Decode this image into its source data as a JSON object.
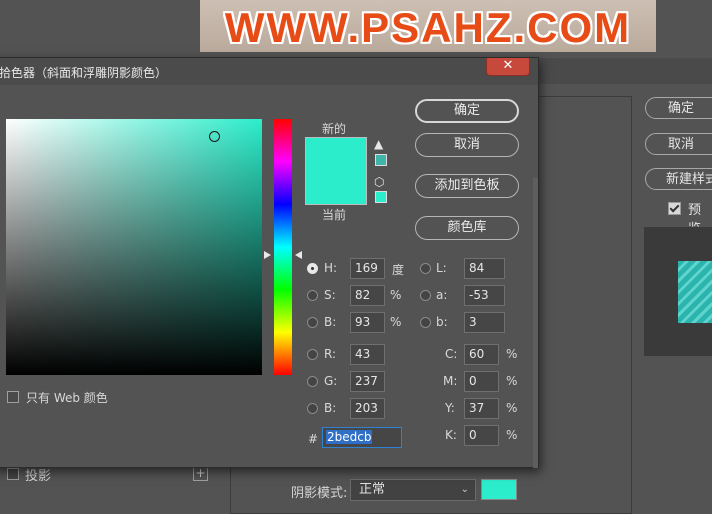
{
  "banner": {
    "text": "WWW.PSAHZ.COM"
  },
  "background_dialog": {
    "buttons": [
      "确定",
      "取消",
      "新建样式",
      "预览"
    ],
    "preview_checked": true,
    "layer_list": {
      "shadow_label": "投影",
      "add_icon": "plus-icon"
    },
    "shadow_mode": {
      "label": "阴影模式:",
      "value": "正常",
      "swatch_color": "#2bedcb"
    }
  },
  "picker": {
    "title": "拾色器（斜面和浮雕阴影颜色）",
    "close_label": "✕",
    "new_label": "新的",
    "current_label": "当前",
    "new_color": "#2bedcb",
    "current_color": "#2bedcb",
    "warning_icon": "gamut-warning-icon",
    "web_icon": "web-safe-cube-icon",
    "buttons": {
      "ok": "确定",
      "cancel": "取消",
      "add_swatch": "添加到色板",
      "libraries": "颜色库"
    },
    "web_only_label": "只有 Web 颜色",
    "hsb": {
      "h": {
        "label": "H:",
        "value": "169",
        "unit": "度"
      },
      "s": {
        "label": "S:",
        "value": "82",
        "unit": "%"
      },
      "b": {
        "label": "B:",
        "value": "93",
        "unit": "%"
      }
    },
    "rgb": {
      "r": {
        "label": "R:",
        "value": "43"
      },
      "g": {
        "label": "G:",
        "value": "237"
      },
      "b": {
        "label": "B:",
        "value": "203"
      }
    },
    "lab": {
      "l": {
        "label": "L:",
        "value": "84"
      },
      "a": {
        "label": "a:",
        "value": "-53"
      },
      "b": {
        "label": "b:",
        "value": "3"
      }
    },
    "cmyk": {
      "c": {
        "label": "C:",
        "value": "60",
        "unit": "%"
      },
      "m": {
        "label": "M:",
        "value": "0",
        "unit": "%"
      },
      "y": {
        "label": "Y:",
        "value": "37",
        "unit": "%"
      },
      "k": {
        "label": "K:",
        "value": "0",
        "unit": "%"
      }
    },
    "hex": {
      "label": "#",
      "value": "2bedcb"
    },
    "selected_mode": "H"
  }
}
